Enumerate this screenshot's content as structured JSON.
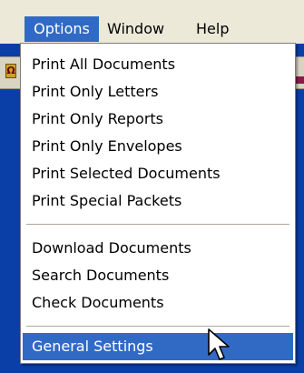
{
  "menubar": {
    "items": [
      {
        "label": "Options",
        "active": true
      },
      {
        "label": "Window",
        "active": false
      },
      {
        "label": "Help",
        "active": false
      }
    ]
  },
  "options_menu": {
    "groups": [
      {
        "items": [
          {
            "label": "Print All Documents"
          },
          {
            "label": "Print Only Letters"
          },
          {
            "label": "Print Only Reports"
          },
          {
            "label": "Print Only Envelopes"
          },
          {
            "label": "Print Selected Documents"
          },
          {
            "label": "Print Special Packets"
          }
        ]
      },
      {
        "items": [
          {
            "label": "Download Documents"
          },
          {
            "label": "Search Documents"
          },
          {
            "label": "Check Documents"
          }
        ]
      },
      {
        "items": [
          {
            "label": "General Settings",
            "highlighted": true
          }
        ]
      }
    ]
  },
  "colors": {
    "highlight": "#316AC5",
    "menubar_bg": "#ECE9D8",
    "app_background": "#0A3FA8",
    "separator": "#ACA899"
  },
  "icons": {
    "cursor": "arrow-pointer-icon",
    "background_toolbar": "toolbar-button-icon"
  }
}
